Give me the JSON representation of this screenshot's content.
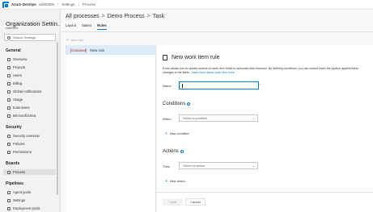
{
  "topbar": {
    "brand": "Azure DevOps",
    "org": "vskb0900",
    "breadcrumb": [
      "Settings",
      "Process"
    ]
  },
  "sidebar": {
    "org_title": "Organization Settin...",
    "org_sub": "vskb0900",
    "search_placeholder": "Search Settings",
    "sections": [
      {
        "title": "General",
        "items": [
          "Overview",
          "Projects",
          "Users",
          "Billing",
          "Global notifications",
          "Usage",
          "Extensions",
          "Microsoft Entra"
        ]
      },
      {
        "title": "Security",
        "items": [
          "Security overview",
          "Policies",
          "Permissions"
        ]
      },
      {
        "title": "Boards",
        "items": [
          "Process"
        ]
      },
      {
        "title": "Pipelines",
        "items": [
          "Agent pools",
          "Settings",
          "Deployment pools"
        ]
      }
    ],
    "active_item": "Process"
  },
  "header": {
    "crumbs": [
      "All processes",
      "Demo Process",
      "Task"
    ],
    "tabs": [
      "Layout",
      "States",
      "Rules"
    ],
    "active_tab": "Rules"
  },
  "rules": {
    "new_rule_button": "New rule",
    "list": [
      {
        "status": "[Unsaved]",
        "name": "New rule"
      }
    ]
  },
  "panel": {
    "title": "New work item rule",
    "description": "A rule allows you to specify actions on work item fields to automate their behavior. By defining conditions, you can control when the system applies these changes to the fields.",
    "learn_more": "Learn more about work item rules",
    "name_label": "Name",
    "name_value": "",
    "required_mark": "*",
    "conditions_title": "Conditions",
    "when_label": "When",
    "condition_placeholder": "Select a condition",
    "new_condition": "New condition",
    "actions_title": "Actions",
    "then_label": "Then",
    "action_placeholder": "Select an action",
    "new_action": "New action",
    "save_label": "Save",
    "cancel_label": "Cancel"
  },
  "colors": {
    "accent": "#0078d4",
    "unsaved": "#a4262c",
    "selected_row": "#deecf9"
  }
}
